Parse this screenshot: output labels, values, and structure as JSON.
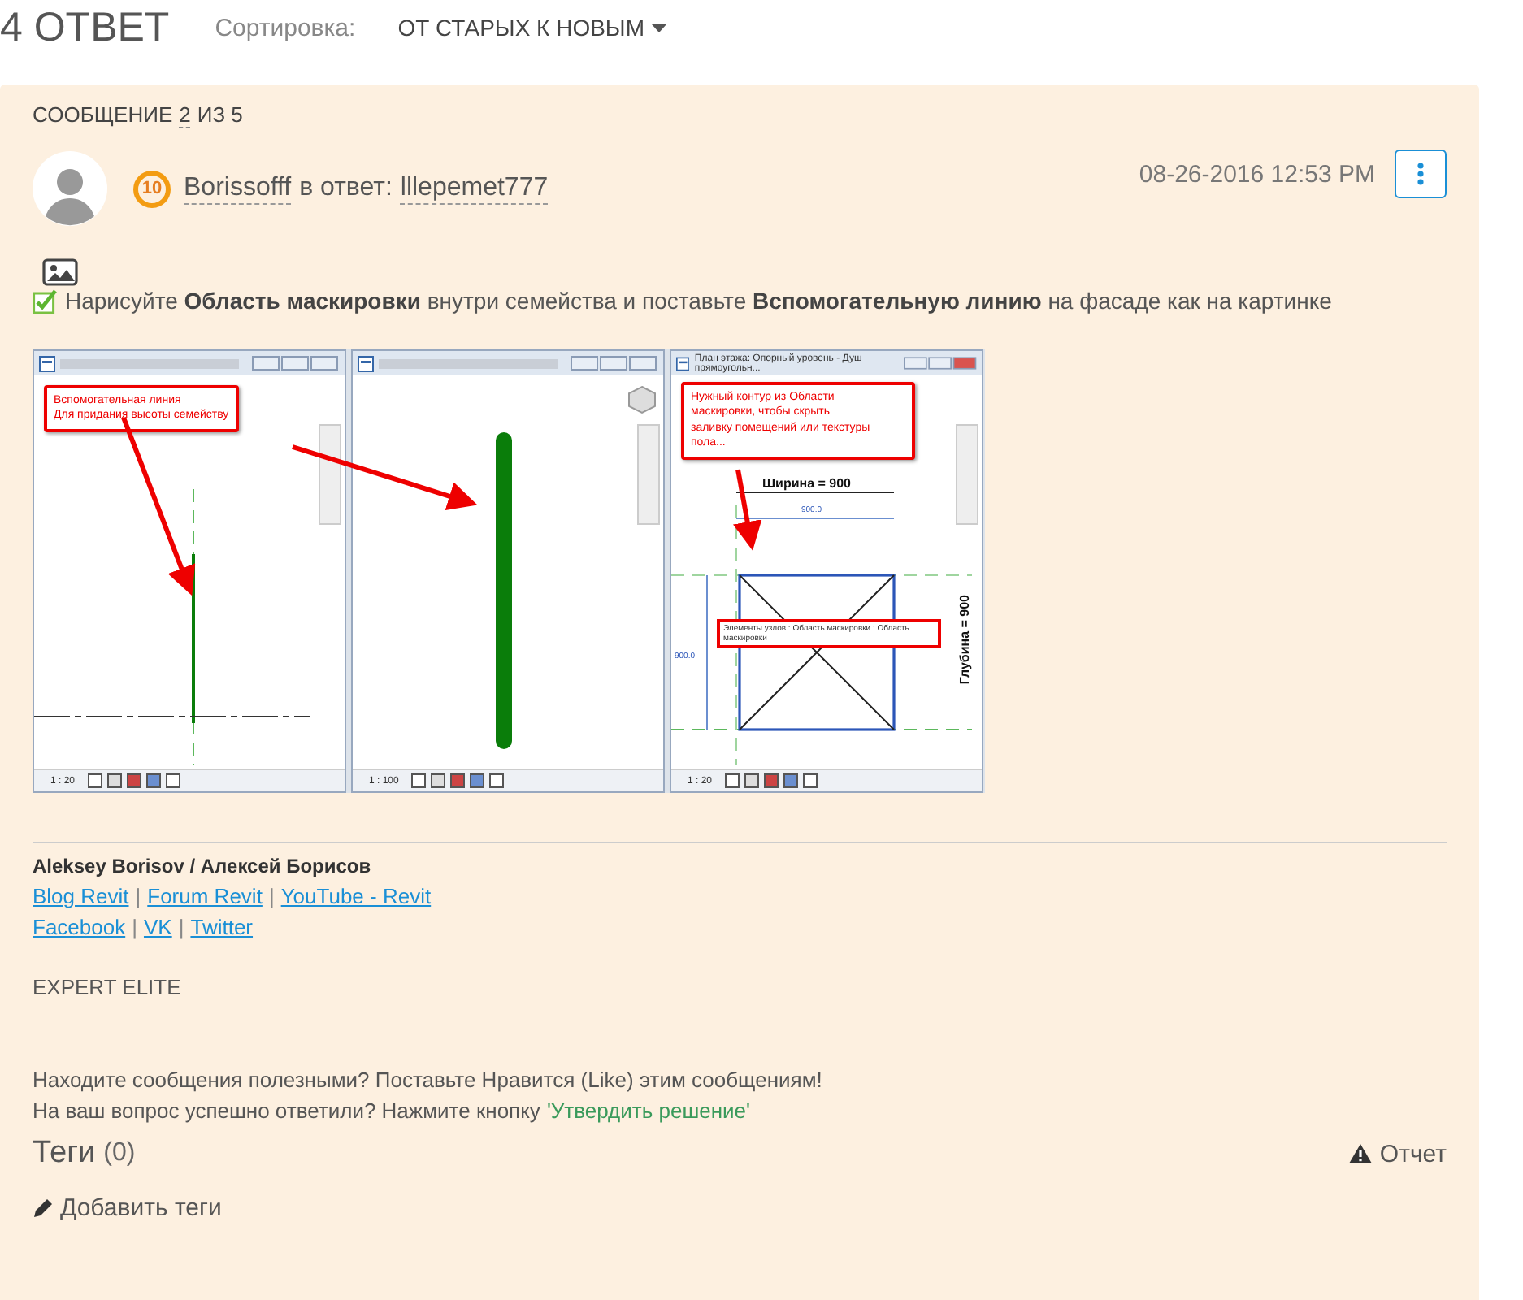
{
  "header": {
    "count_title": "4 ОТВЕТ",
    "sort_label": "Сортировка:",
    "sort_value": "ОТ СТАРЫХ К НОВЫМ"
  },
  "post": {
    "position": {
      "prefix": "СООБЩЕНИЕ",
      "current": "2",
      "suffix": "ИЗ 5"
    },
    "rank": "10",
    "author": "Borissofff",
    "reply_to_label": "в ответ:",
    "reply_to": "lllepemet777",
    "date": "08-26-2016 12:53 PM",
    "body_text": "Нарисуйте **Область маскировки** внутри семейства и поставьте **Вспомогательную линию** на фасаде как на картинке",
    "screenshot": {
      "panels": [
        {
          "kind": "elevation",
          "scale": "1 : 20",
          "callout": [
            "Вспомогательная линия",
            "Для придания высоты семейству"
          ]
        },
        {
          "kind": "view3d",
          "scale": "1 : 100"
        },
        {
          "kind": "plan",
          "title": "План этажа: Опорный уровень - Душ прямоугольн...",
          "scale": "1 : 20",
          "callout": [
            "Нужный контур из Области",
            "маскировки, чтобы скрыть",
            "заливку помещений или текстуры",
            "пола..."
          ],
          "width_label": "Ширина = 900",
          "depth_label": "Глубина = 900",
          "dimension": "900.0",
          "side_dimension": "900.0",
          "tooltip": "Элементы узлов : Область маскировки : Область маскировки"
        }
      ]
    },
    "signature": {
      "name": "Aleksey Borisov / Алексей Борисов",
      "link_rows": [
        [
          "Blog Revit",
          "Forum Revit",
          "YouTube - Revit"
        ],
        [
          "Facebook",
          "VK",
          "Twitter"
        ]
      ],
      "separator": "|",
      "badge": "EXPERT ELITE",
      "note_line": "Находите сообщения полезными? Поставьте Нравится (Like) этим сообщениям!",
      "accept_prefix": "На ваш вопрос успешно ответили? Нажмите кнопку",
      "accept_link": "'Утвердить решение'"
    },
    "tags": {
      "title": "Теги",
      "count": "(0)",
      "add": "Добавить теги"
    },
    "report": "Отчет"
  }
}
